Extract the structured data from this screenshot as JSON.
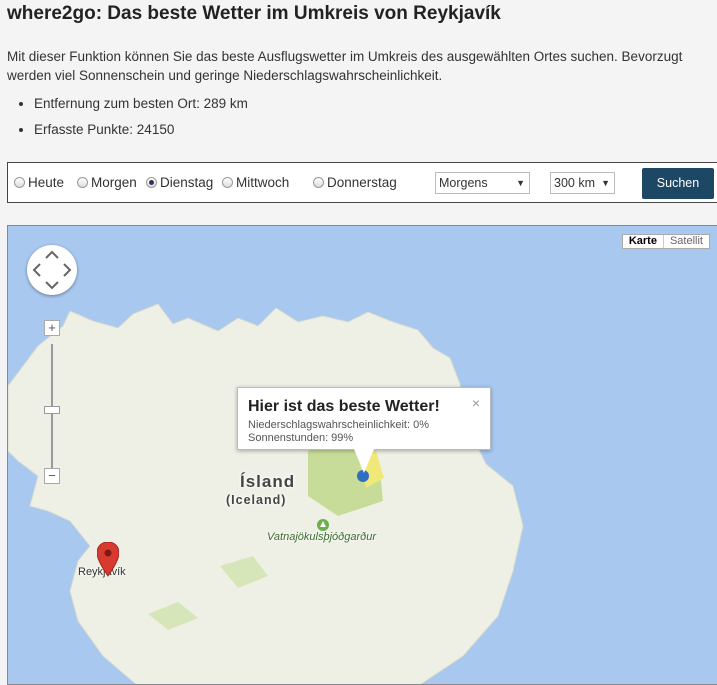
{
  "header": {
    "title": "where2go: Das beste Wetter im Umkreis von Reykjavík",
    "intro": "Mit dieser Funktion können Sie das beste Ausflugswetter im Umkreis des ausgewählten Ortes suchen. Bevorzugt werden viel Sonnenschein und geringe Niederschlagswahrscheinlichkeit."
  },
  "facts": [
    "Entfernung zum besten Ort: 289 km",
    "Erfasste Punkte: 24150"
  ],
  "form": {
    "days": [
      "Heute",
      "Morgen",
      "Dienstag",
      "Mittwoch",
      "Donnerstag"
    ],
    "selected_day": "Dienstag",
    "time_of_day": "Morgens",
    "radius": "300 km",
    "search_label": "Suchen"
  },
  "map": {
    "type_buttons": [
      "Karte",
      "Satellit"
    ],
    "active_type": "Karte",
    "zoom_in": "+",
    "zoom_out": "−",
    "country_label": "Ísland",
    "country_label_en": "(Iceland)",
    "park_label": "Vatnajökulsþjóðgarður",
    "city_label": "Reykjavík",
    "popup": {
      "title": "Hier ist das beste Wetter!",
      "line1": "Niederschlagswahrscheinlichkeit: 0%",
      "line2": "Sonnenstunden: 99%",
      "close": "×"
    }
  },
  "colors": {
    "button_bg": "#1c4866",
    "water": "#a8c8f0",
    "land": "#eef0e6",
    "green_area": "#c8dc9a",
    "marker": "#d93a30"
  }
}
